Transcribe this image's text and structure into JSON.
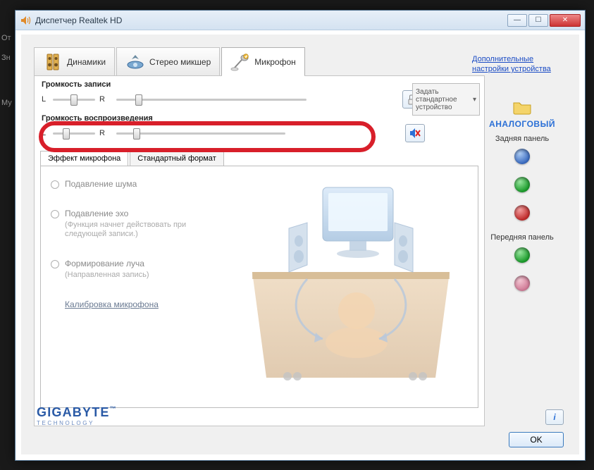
{
  "window": {
    "title": "Диспетчер Realtek HD"
  },
  "tabs": {
    "speakers": "Динамики",
    "stereo_mix": "Стерео микшер",
    "microphone": "Микрофон"
  },
  "advanced_link": "Дополнительные настройки устройства",
  "recording": {
    "label": "Громкость записи",
    "L": "L",
    "R": "R"
  },
  "playback": {
    "label": "Громкость воспроизведения",
    "L": "L",
    "R": "R"
  },
  "default_device": "Задать стандартное устройство",
  "subtabs": {
    "mic_effect": "Эффект микрофона",
    "default_format": "Стандартный формат"
  },
  "options": {
    "noise": "Подавление шума",
    "echo": "Подавление эхо",
    "echo_sub": "(Функция начнет действовать при следующей записи.)",
    "beam": "Формирование луча",
    "beam_sub": "(Направленная запись)",
    "calibrate": "Калибровка микрофона"
  },
  "right": {
    "analog": "АНАЛОГОВЫЙ",
    "rear": "Задняя панель",
    "front": "Передняя панель"
  },
  "brand": {
    "name": "GIGABYTE",
    "tech": "TECHNOLOGY"
  },
  "buttons": {
    "ok": "OK",
    "info": "i"
  },
  "bg": {
    "t1": "От",
    "t2": "Зн",
    "t3": "Му"
  }
}
